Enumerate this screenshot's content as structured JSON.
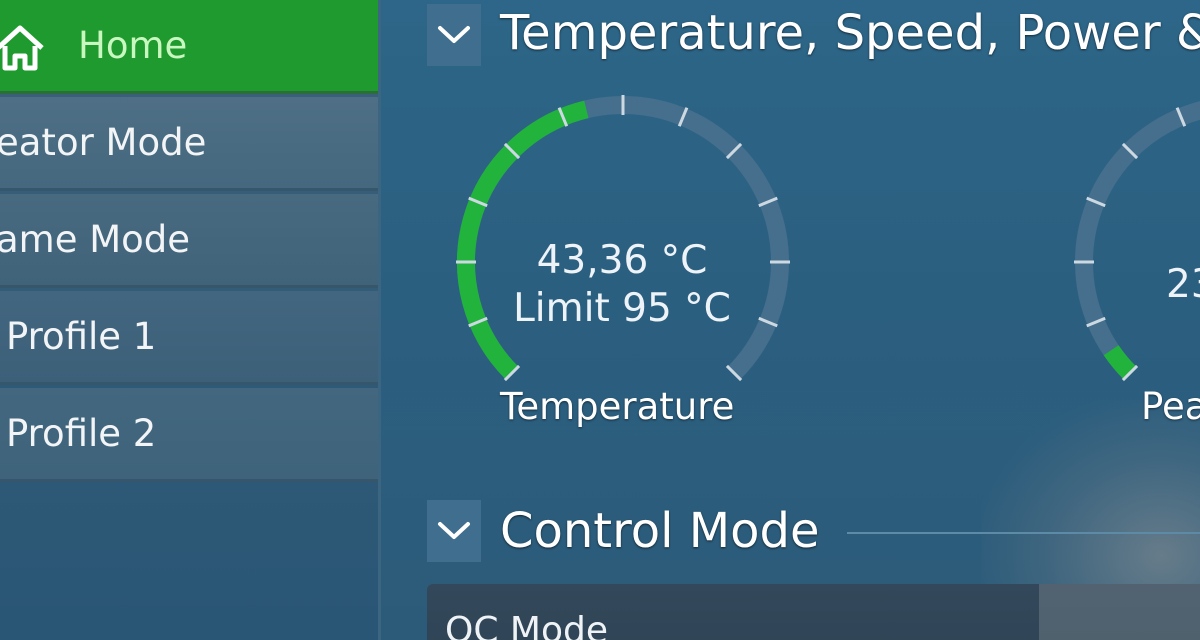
{
  "sidebar": {
    "items": [
      {
        "label": "Home",
        "active": true,
        "icon": "home-icon"
      },
      {
        "label": "eator Mode"
      },
      {
        "label": "ame Mode"
      },
      {
        "label": "Profile 1"
      },
      {
        "label": "Profile 2"
      }
    ]
  },
  "sections": {
    "temperature": {
      "title": "Temperature, Speed, Power &"
    },
    "control": {
      "title": "Control Mode",
      "current_mode": "OC Mode"
    }
  },
  "gauges": [
    {
      "label": "Temperature",
      "value": "43,36 °C",
      "limit": "Limit 95 °C",
      "fill_fraction": 0.45
    },
    {
      "label": "Pea",
      "value": "23",
      "fill_fraction": 0.04
    }
  ],
  "colors": {
    "accent_green": "#22b33c",
    "track": "#456f8c",
    "tick": "#cdd9e2"
  }
}
